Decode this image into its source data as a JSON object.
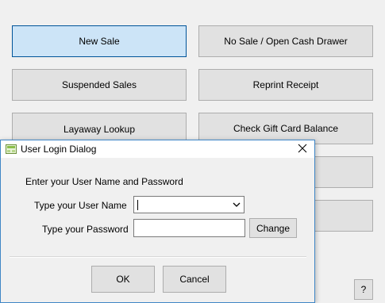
{
  "main_buttons": {
    "new_sale": "New Sale",
    "no_sale": "No Sale / Open Cash Drawer",
    "suspended_sales": "Suspended Sales",
    "reprint_receipt": "Reprint Receipt",
    "layaway_lookup": "Layaway Lookup",
    "check_gift_card": "Check Gift Card Balance",
    "help": "?"
  },
  "dialog": {
    "title": "User Login Dialog",
    "prompt": "Enter your User Name and Password",
    "username_label": "Type your User Name",
    "username_value": "",
    "password_label": "Type your Password",
    "password_value": "",
    "change_label": "Change",
    "ok_label": "OK",
    "cancel_label": "Cancel"
  },
  "icons": {
    "app": "app-icon",
    "close": "close-icon",
    "dropdown": "chevron-down-icon"
  },
  "colors": {
    "primary_button_bg": "#cce4f7",
    "primary_button_border": "#005499",
    "dialog_border": "#3f86c6"
  }
}
